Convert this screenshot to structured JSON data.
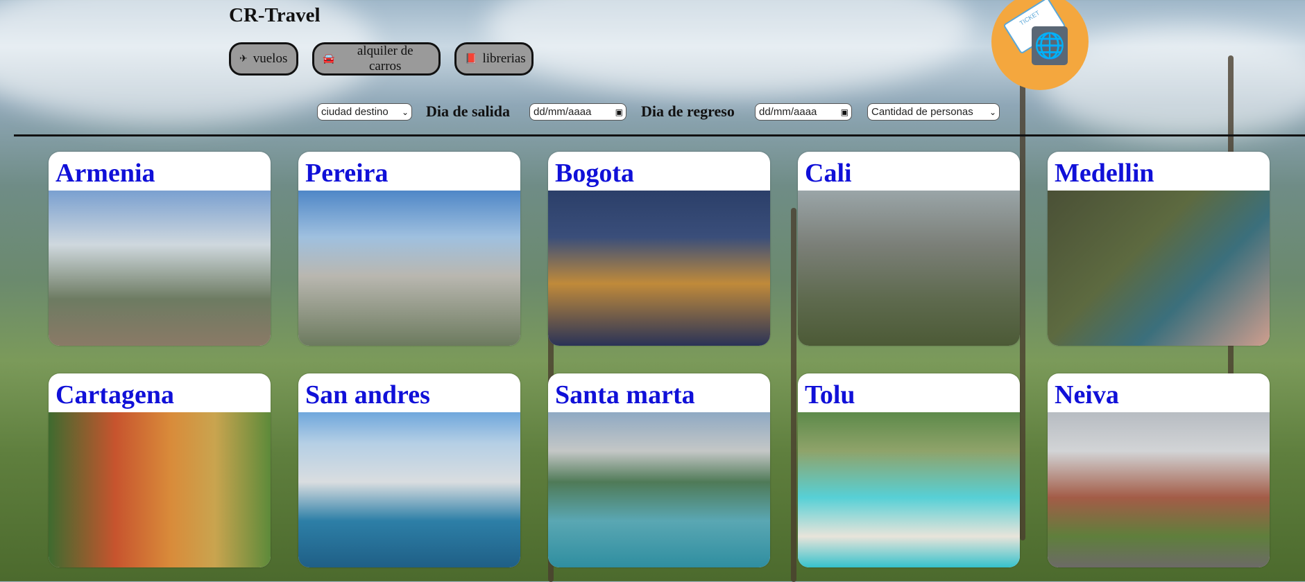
{
  "header": {
    "brand": "CR-Travel",
    "nav": [
      {
        "icon": "plane-icon",
        "glyph": "✈",
        "label": "vuelos"
      },
      {
        "icon": "car-icon",
        "glyph": "🚘",
        "label": "alquiler de carros"
      },
      {
        "icon": "book-icon",
        "glyph": "📕",
        "label": "librerias"
      }
    ],
    "logo": {
      "ticket_text": "TICKET",
      "globe": "🌐"
    }
  },
  "search": {
    "destination_select": "ciudad destino",
    "departure_label": "Dia de salida",
    "departure_date": "dd/mm/aaaa",
    "return_label": "Dia de regreso",
    "return_date": "dd/mm/aaaa",
    "people_select": "Cantidad de personas"
  },
  "destinations": [
    {
      "name": "Armenia"
    },
    {
      "name": "Pereira"
    },
    {
      "name": "Bogota"
    },
    {
      "name": "Cali"
    },
    {
      "name": "Medellin"
    },
    {
      "name": "Cartagena"
    },
    {
      "name": "San andres"
    },
    {
      "name": "Santa marta"
    },
    {
      "name": "Tolu"
    },
    {
      "name": "Neiva"
    }
  ],
  "colors": {
    "title_blue": "#1010d8",
    "button_gray": "#9a9a9a",
    "logo_orange": "#f4a73e"
  }
}
